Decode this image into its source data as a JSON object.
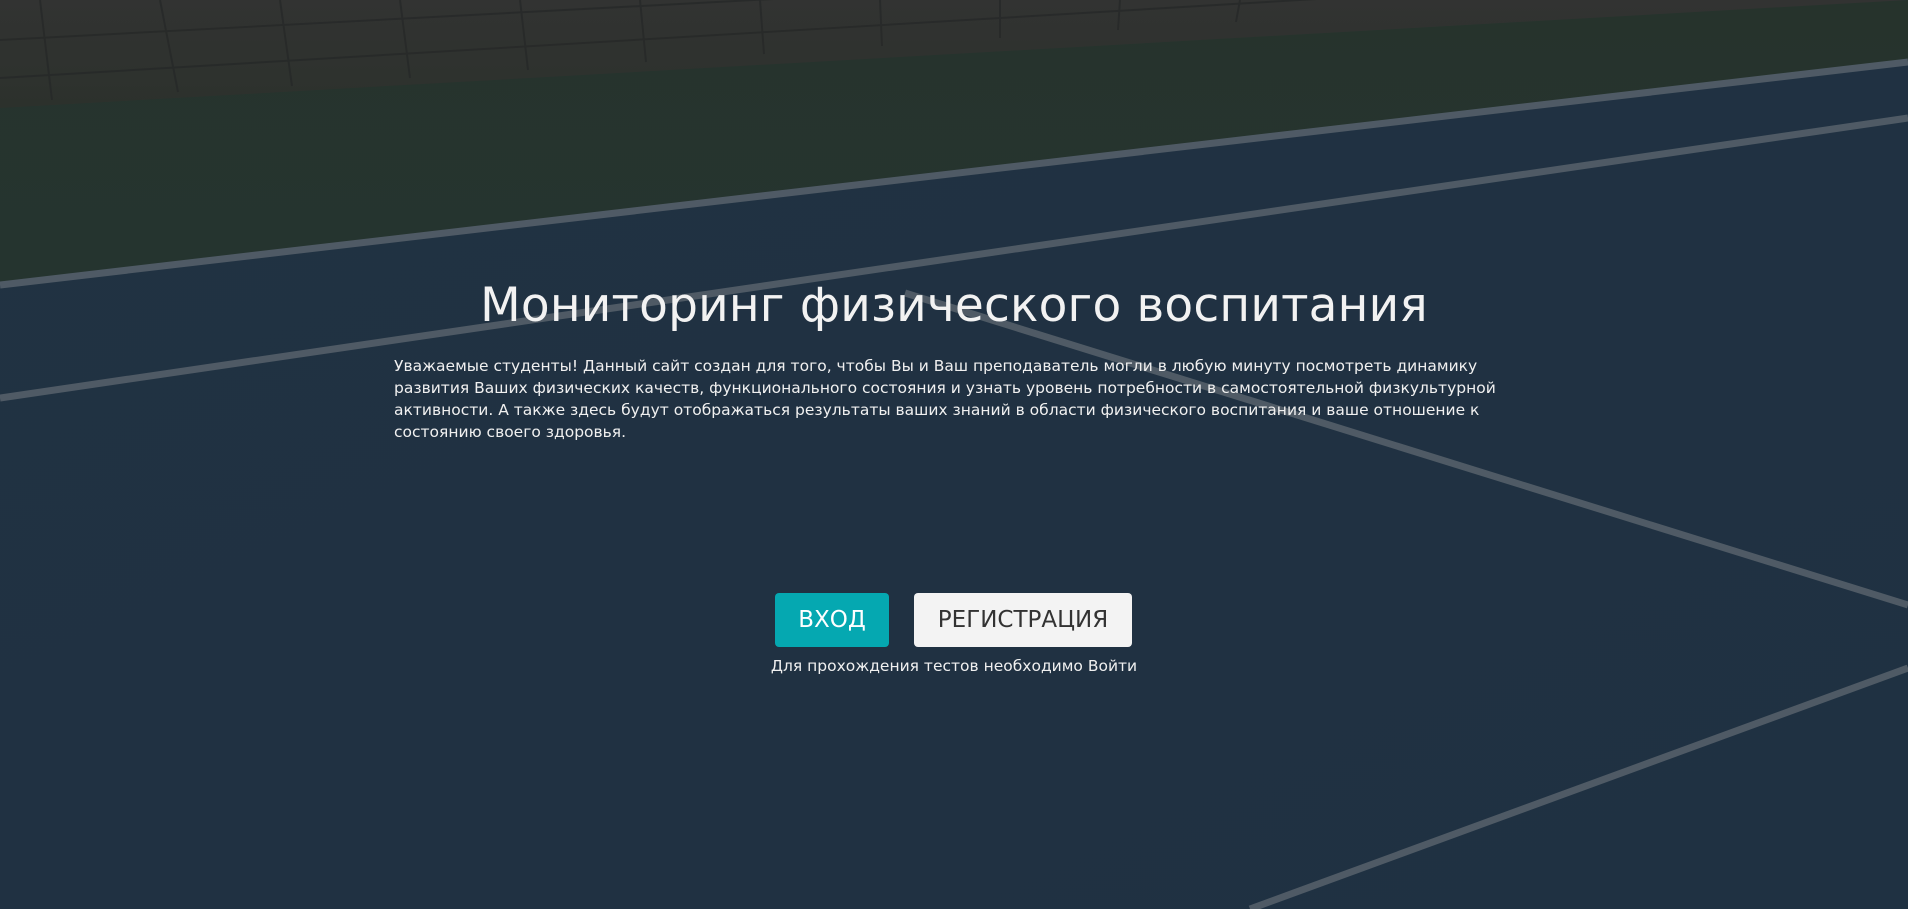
{
  "hero": {
    "title": "Мониторинг физического воспитания",
    "description": "Уважаемые студенты! Данный сайт создан для того, чтобы Вы и Ваш преподаватель могли в любую минуту посмотреть динамику развития Ваших физических качеств, функционального состояния и узнать уровень потребности в самостоятельной физкультурной активности. А также здесь будут отображаться результаты ваших знаний в области физического воспитания и ваше отношение к состоянию своего здоровья.",
    "login_label": "Вход",
    "register_label": "Регистрация",
    "hint": "Для прохождения тестов необходимо Войти"
  },
  "colors": {
    "accent": "#05a8b1",
    "court": "#273847",
    "register_bg": "#f3f3f3"
  }
}
